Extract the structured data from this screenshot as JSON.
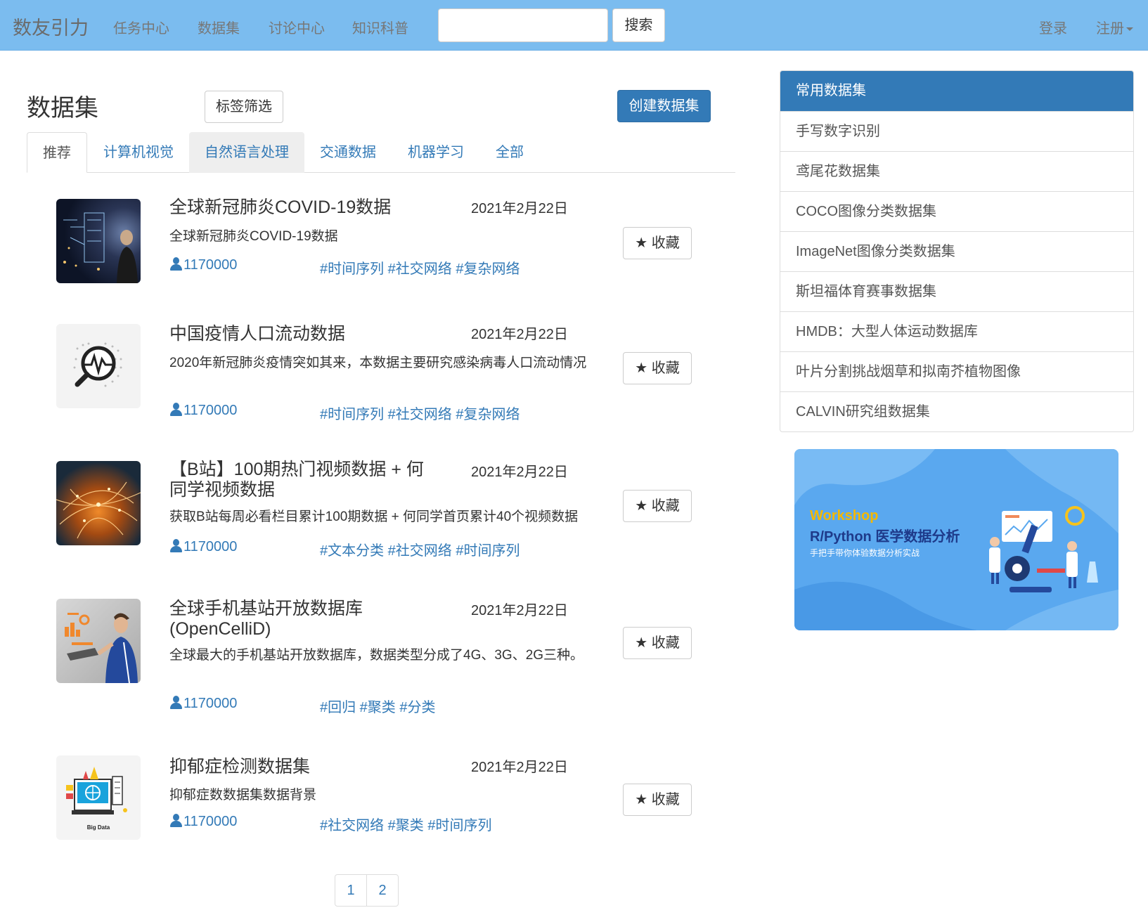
{
  "navbar": {
    "brand": "数友引力",
    "items": [
      "任务中心",
      "数据集",
      "讨论中心",
      "知识科普"
    ],
    "search_value": "",
    "search_button": "搜索",
    "login": "登录",
    "register": "注册"
  },
  "page": {
    "title": "数据集",
    "tag_filter": "标签筛选",
    "create_button": "创建数据集"
  },
  "tabs": [
    "推荐",
    "计算机视觉",
    "自然语言处理",
    "交通数据",
    "机器学习",
    "全部"
  ],
  "datasets": [
    {
      "title": "全球新冠肺炎COVID-19数据",
      "date": "2021年2月22日",
      "desc": "全球新冠肺炎COVID-19数据",
      "users": "1170000",
      "tags": "#时间序列 #社交网络 #复杂网络",
      "fav": "★ 收藏",
      "thumb_icon": "dark-city-touchscreen-image"
    },
    {
      "title": "中国疫情人口流动数据",
      "date": "2021年2月22日",
      "desc": "2020年新冠肺炎疫情突如其来，本数据主要研究感染病毒人口流动情况",
      "users": "1170000",
      "tags": "#时间序列 #社交网络 #复杂网络",
      "fav": "★ 收藏",
      "thumb_icon": "magnifier-pulse-icon"
    },
    {
      "title": "【B站】100期热门视频数据 + 何同学视频数据",
      "date": "2021年2月22日",
      "desc": "获取B站每周必看栏目累计100期数据 + 何同学首页累计40个视频数据",
      "users": "1170000",
      "tags": "#文本分类 #社交网络 #时间序列",
      "fav": "★ 收藏",
      "thumb_icon": "network-city-image"
    },
    {
      "title": "全球手机基站开放数据库(OpenCelliD)",
      "date": "2021年2月22日",
      "desc": "全球最大的手机基站开放数据库，数据类型分成了4G、3G、2G三种。",
      "users": "1170000",
      "tags": "#回归 #聚类 #分类",
      "fav": "★ 收藏",
      "thumb_icon": "man-with-tablet-image"
    },
    {
      "title": "抑郁症检测数据集",
      "date": "2021年2月22日",
      "desc": "抑郁症数数据集数据背景",
      "users": "1170000",
      "tags": "#社交网络 #聚类 #时间序列",
      "fav": "★ 收藏",
      "thumb_icon": "big-data-illustration",
      "thumb_caption": "Big Data"
    }
  ],
  "pagination": [
    "1",
    "2"
  ],
  "sidebar": {
    "heading": "常用数据集",
    "items": [
      "手写数字识别",
      "鸢尾花数据集",
      "COCO图像分类数据集",
      "ImageNet图像分类数据集",
      "斯坦福体育赛事数据集",
      "HMDB：大型人体运动数据库",
      "叶片分割挑战烟草和拟南芥植物图像",
      "CALVIN研究组数据集"
    ]
  },
  "banner": {
    "line1": "Workshop",
    "line2": "R/Python 医学数据分析",
    "line3": "手把手带你体验数据分析实战"
  },
  "colors": {
    "navbar": "#7bbcef",
    "primary": "#337ab7",
    "link": "#337ab7",
    "banner_bg": "#5aa8ef",
    "banner_accent": "#f5b800"
  }
}
